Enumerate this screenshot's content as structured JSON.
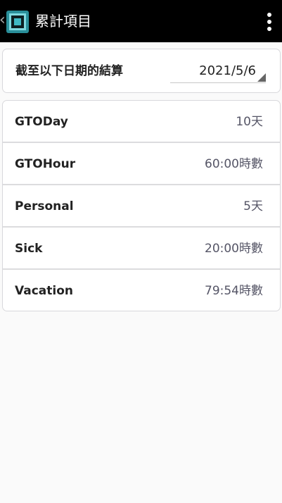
{
  "appbar": {
    "title": "累計項目",
    "back_glyph": "‹",
    "logo_icon": "app-logo-icon",
    "menu_icon": "more-vert-icon",
    "background": "#000000",
    "logo_color": "#3fb9c4"
  },
  "date_filter": {
    "label": "截至以下日期的結算",
    "value": "2021/5/6"
  },
  "items": [
    {
      "label": "GTODay",
      "value": "10天"
    },
    {
      "label": "GTOHour",
      "value": "60:00時數"
    },
    {
      "label": "Personal",
      "value": "5天"
    },
    {
      "label": "Sick",
      "value": "20:00時數"
    },
    {
      "label": "Vacation",
      "value": "79:54時數"
    }
  ]
}
